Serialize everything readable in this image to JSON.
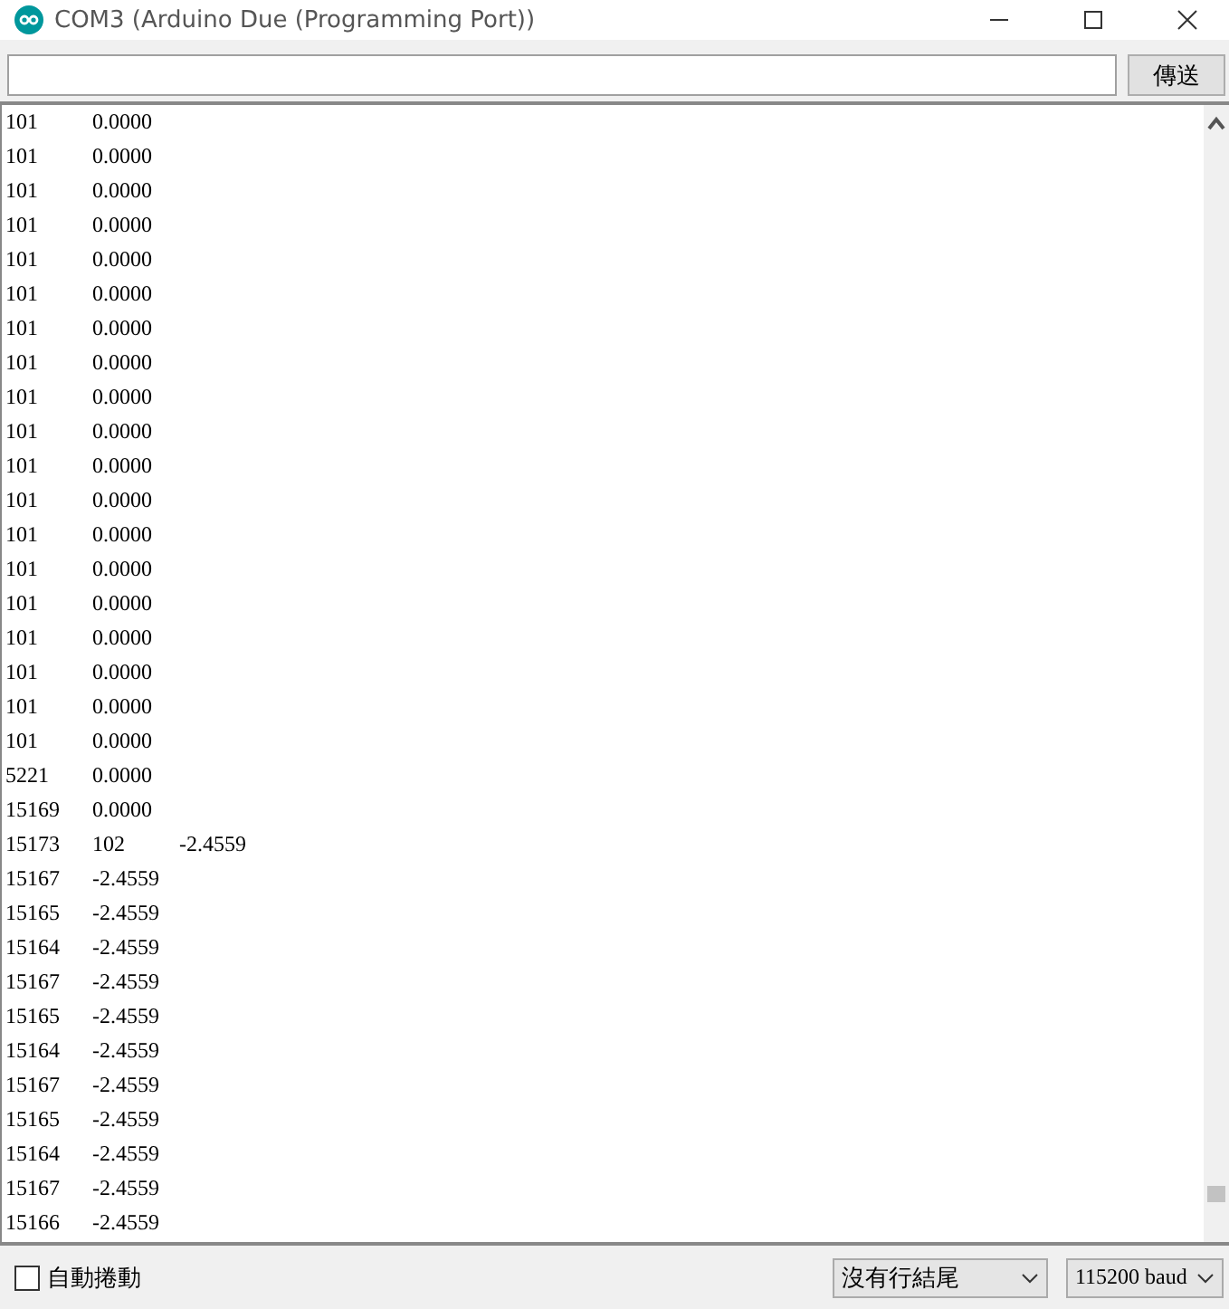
{
  "window": {
    "title": "COM3 (Arduino Due (Programming Port))"
  },
  "send_button": "傳送",
  "output_lines": [
    [
      "101",
      "0.0000"
    ],
    [
      "101",
      "0.0000"
    ],
    [
      "101",
      "0.0000"
    ],
    [
      "101",
      "0.0000"
    ],
    [
      "101",
      "0.0000"
    ],
    [
      "101",
      "0.0000"
    ],
    [
      "101",
      "0.0000"
    ],
    [
      "101",
      "0.0000"
    ],
    [
      "101",
      "0.0000"
    ],
    [
      "101",
      "0.0000"
    ],
    [
      "101",
      "0.0000"
    ],
    [
      "101",
      "0.0000"
    ],
    [
      "101",
      "0.0000"
    ],
    [
      "101",
      "0.0000"
    ],
    [
      "101",
      "0.0000"
    ],
    [
      "101",
      "0.0000"
    ],
    [
      "101",
      "0.0000"
    ],
    [
      "101",
      "0.0000"
    ],
    [
      "101",
      "0.0000"
    ],
    [
      "5221",
      "0.0000"
    ],
    [
      "15169",
      "0.0000"
    ],
    [
      "15173",
      "102",
      "-2.4559"
    ],
    [
      "15167",
      "-2.4559"
    ],
    [
      "15165",
      "-2.4559"
    ],
    [
      "15164",
      "-2.4559"
    ],
    [
      "15167",
      "-2.4559"
    ],
    [
      "15165",
      "-2.4559"
    ],
    [
      "15164",
      "-2.4559"
    ],
    [
      "15167",
      "-2.4559"
    ],
    [
      "15165",
      "-2.4559"
    ],
    [
      "15164",
      "-2.4559"
    ],
    [
      "15167",
      "-2.4559"
    ],
    [
      "15166",
      "-2.4559"
    ]
  ],
  "autoscroll": {
    "label": "自動捲動",
    "checked": false
  },
  "line_ending": "沒有行結尾",
  "baud_rate": "115200 baud"
}
